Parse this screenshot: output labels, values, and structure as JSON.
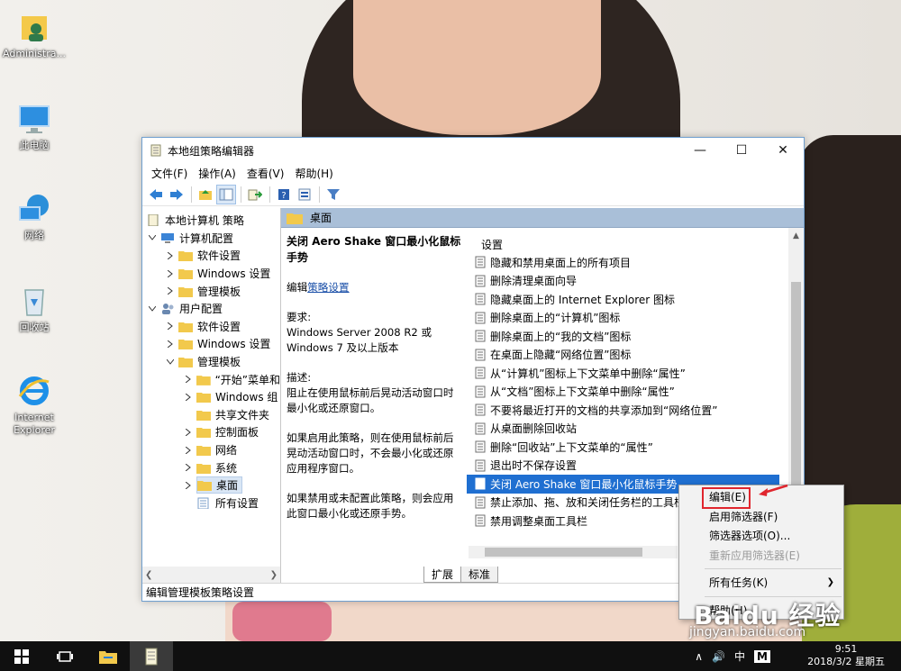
{
  "desktop": {
    "icons": [
      {
        "label": "Administra..."
      },
      {
        "label": "此电脑"
      },
      {
        "label": "网络"
      },
      {
        "label": "回收站"
      },
      {
        "label": "Internet Explorer"
      }
    ]
  },
  "window": {
    "title": "本地组策略编辑器",
    "controls": {
      "minimize": "—",
      "maximize": "☐",
      "close": "✕"
    },
    "menu": [
      "文件(F)",
      "操作(A)",
      "查看(V)",
      "帮助(H)"
    ]
  },
  "tree": {
    "root": "本地计算机 策略",
    "items": [
      {
        "label": "计算机配置"
      },
      {
        "label": "软件设置"
      },
      {
        "label": "Windows 设置"
      },
      {
        "label": "管理模板"
      },
      {
        "label": "用户配置"
      },
      {
        "label": "软件设置"
      },
      {
        "label": "Windows 设置"
      },
      {
        "label": "管理模板"
      },
      {
        "label": "“开始”菜单和"
      },
      {
        "label": "Windows 组"
      },
      {
        "label": "共享文件夹"
      },
      {
        "label": "控制面板"
      },
      {
        "label": "网络"
      },
      {
        "label": "系统"
      },
      {
        "label": "桌面"
      },
      {
        "label": "所有设置"
      }
    ]
  },
  "content": {
    "header": "桌面",
    "description": {
      "title": "关闭 Aero Shake 窗口最小化鼠标手势",
      "edit_prefix": "编辑",
      "edit_link": "策略设置",
      "req_label": "要求:",
      "req_text": "Windows Server 2008 R2 或 Windows 7 及以上版本",
      "desc_label": "描述:",
      "desc_text": "阻止在使用鼠标前后晃动活动窗口时最小化或还原窗口。",
      "p2": "如果启用此策略，则在使用鼠标前后晃动活动窗口时，不会最小化或还原应用程序窗口。",
      "p3": "如果禁用或未配置此策略，则会应用此窗口最小化或还原手势。"
    },
    "list_header": "设置",
    "settings": [
      "隐藏和禁用桌面上的所有项目",
      "删除清理桌面向导",
      "隐藏桌面上的 Internet Explorer 图标",
      "删除桌面上的“计算机”图标",
      "删除桌面上的“我的文档”图标",
      "在桌面上隐藏“网络位置”图标",
      "从“计算机”图标上下文菜单中删除“属性”",
      "从“文档”图标上下文菜单中删除“属性”",
      "不要将最近打开的文档的共享添加到“网络位置”",
      "从桌面删除回收站",
      "删除“回收站”上下文菜单的“属性”",
      "退出时不保存设置",
      "关闭 Aero Shake 窗口最小化鼠标手势",
      "禁止添加、拖、放和关闭任务栏的工具栏",
      "禁用调整桌面工具栏"
    ],
    "selected_index": 12,
    "tabs": [
      "扩展",
      "标准"
    ]
  },
  "status": "编辑管理模板策略设置",
  "context_menu": {
    "items": [
      "编辑(E)",
      "启用筛选器(F)",
      "筛选器选项(O)...",
      "重新应用筛选器(E)",
      "所有任务(K)",
      "帮助(H)"
    ]
  },
  "taskbar": {
    "tray": [
      "∧",
      "🔊",
      "中"
    ],
    "ime": "M",
    "time": "9:51",
    "date": "2018/3/2 星期五"
  },
  "watermark": {
    "brand": "Baidu 经验",
    "url": "jingyan.baidu.com"
  },
  "colors": {
    "selection": "#1f6fd1",
    "header": "#a9bfd8",
    "annotation": "#e0262e"
  }
}
